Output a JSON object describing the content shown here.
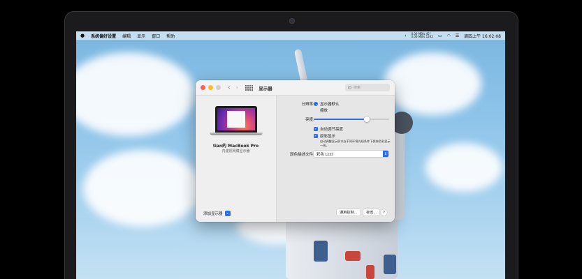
{
  "menubar": {
    "apple": "",
    "app_name": "系统偏好设置",
    "items": [
      "编辑",
      "显示",
      "窗口",
      "帮助"
    ],
    "network_up": "0.00 MB/s 45°",
    "network_down": "0.00 MB/s 1202",
    "datetime": "周四上午 16:02:08"
  },
  "window": {
    "title": "显示器",
    "search_placeholder": "搜索"
  },
  "device": {
    "name": "tian的 MacBook Pro",
    "subtitle": "内建视网膜显示器",
    "add_display": "添加显示器"
  },
  "settings": {
    "resolution_label": "分辨率:",
    "resolution_options": [
      "显示器默认",
      "缩放"
    ],
    "resolution_selected": 0,
    "brightness_label": "亮度:",
    "brightness_level": 0.7,
    "auto_brightness": "自动调节亮度",
    "true_tone": "原彩显示",
    "true_tone_note": "自动调整显示屏以在不同环境光线条件下保持色彩显示一致。",
    "color_profile_label": "颜色描述文件:",
    "color_profile_value": "彩色 LCD"
  },
  "buttons": {
    "universal_control": "通用控制...",
    "night_shift": "夜览...",
    "help": "?"
  },
  "colors": {
    "accent": "#2f6fe0",
    "close": "#fe5f57",
    "minimize": "#febc2e"
  }
}
